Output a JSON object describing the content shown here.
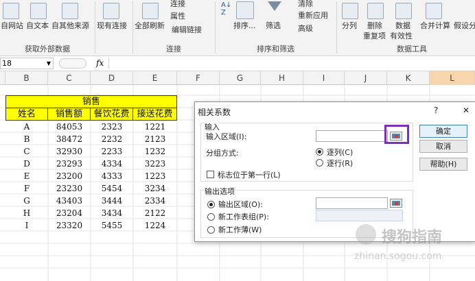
{
  "ribbon": {
    "buttons": {
      "from_web": "自网站",
      "from_text": "自文本",
      "from_other": "自其他来源",
      "existing": "现有连接",
      "refresh_all": "全部刷新",
      "connections": "连接",
      "properties": "属性",
      "edit_links": "编辑链接",
      "sort": "排序...",
      "filter": "筛选",
      "clear": "清除",
      "reapply": "重新应用",
      "advanced": "高级",
      "split": "分列",
      "remove_dup_l1": "删除",
      "remove_dup_l2": "重复项",
      "validation_l1": "数据",
      "validation_l2": "有效性",
      "consolidate": "合并计算",
      "whatif": "假设分"
    },
    "groups": {
      "external": "获取外部数据",
      "connections": "连接",
      "sortfilter": "排序和筛选",
      "tools": "数据工具"
    }
  },
  "formula_bar": {
    "name_box": "18",
    "fx": "fx",
    "value": ""
  },
  "columns": [
    "B",
    "C",
    "D",
    "E",
    "F",
    "G",
    "H",
    "I",
    "J",
    "K",
    "L"
  ],
  "sheet": {
    "title": "销售",
    "headers": [
      "姓名",
      "销售额",
      "餐饮花费",
      "接送花费"
    ],
    "rows": [
      [
        "A",
        "84053",
        "2323",
        "1221"
      ],
      [
        "B",
        "38472",
        "2232",
        "2123"
      ],
      [
        "C",
        "32930",
        "2233",
        "1232"
      ],
      [
        "D",
        "23293",
        "4334",
        "3223"
      ],
      [
        "E",
        "23200",
        "4333",
        "1223"
      ],
      [
        "F",
        "23230",
        "5454",
        "3234"
      ],
      [
        "G",
        "43403",
        "3444",
        "2334"
      ],
      [
        "H",
        "23204",
        "3434",
        "2122"
      ],
      [
        "I",
        "23320",
        "5455",
        "1224"
      ]
    ]
  },
  "dialog": {
    "title": "相关系数",
    "help_glyph": "?",
    "close_glyph": "✕",
    "input_section": "输入",
    "input_range_label": "输入区域(I):",
    "input_range_value": "",
    "grouped_by_label": "分组方式:",
    "by_columns": "逐列(C)",
    "by_rows": "逐行(R)",
    "labels_first_row": "标志位于第一行(L)",
    "output_section": "输出选项",
    "output_range": "输出区域(O):",
    "output_range_value": "",
    "new_sheet": "新工作表组(P):",
    "new_sheet_value": "",
    "new_workbook": "新工作薄(W)",
    "ok": "确定",
    "cancel": "取消",
    "help": "帮助(H)"
  },
  "watermark": {
    "brand": "搜狗指南",
    "url": "zhinan.sogou.com"
  },
  "colors": {
    "yellow": "#ffff00",
    "highlight_box": "#7b2fbf",
    "selected_col": "#f7d6ad"
  }
}
